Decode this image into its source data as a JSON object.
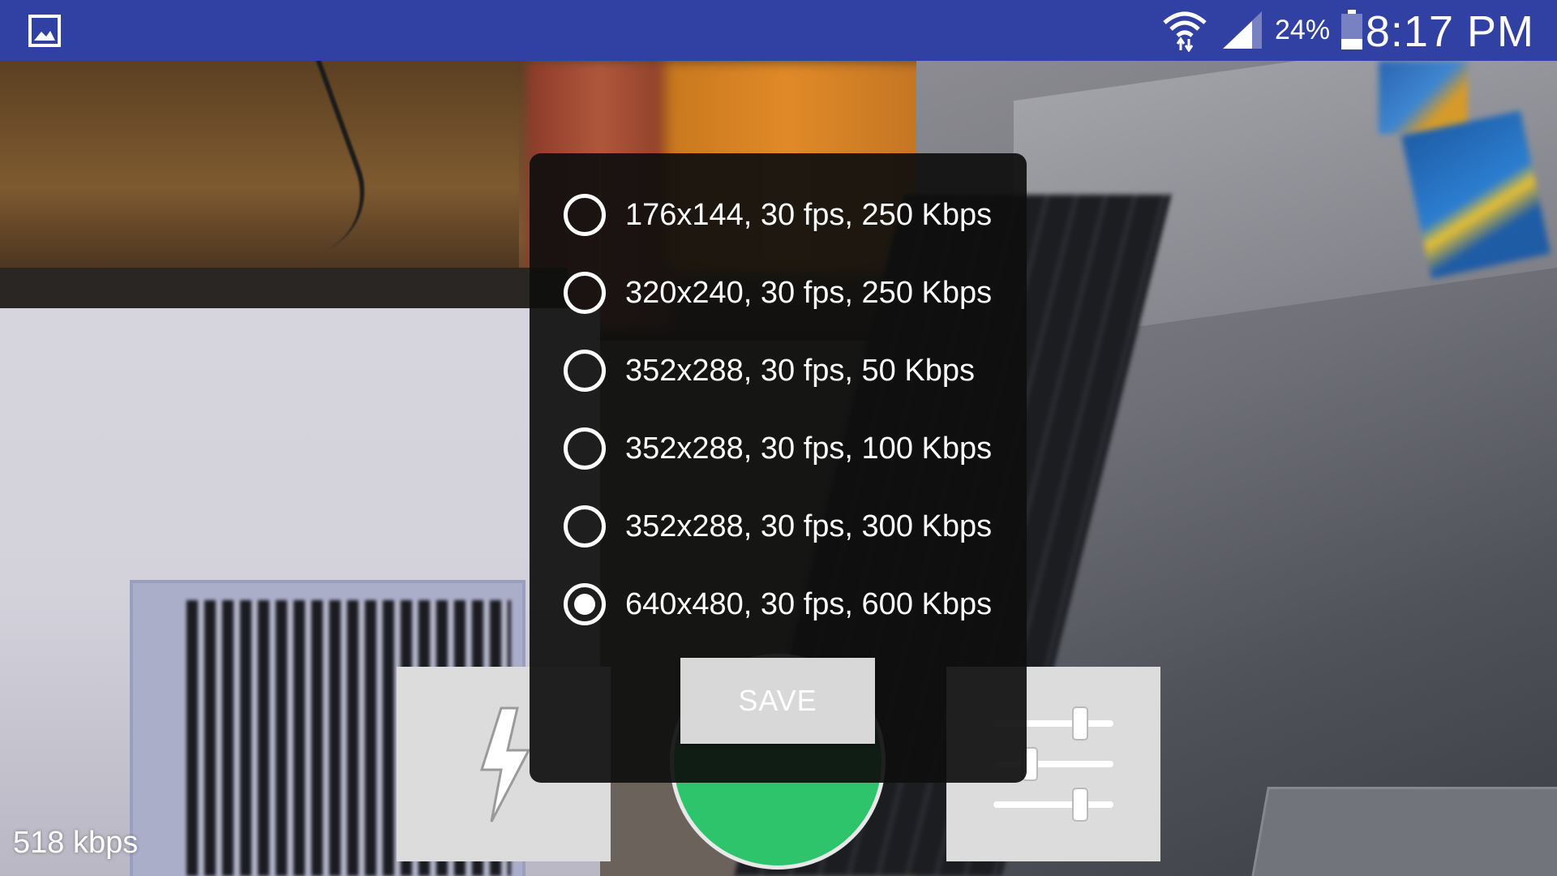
{
  "status_bar": {
    "battery_percent": "24%",
    "time": "8:17 PM",
    "icons": [
      "gallery-icon",
      "wifi-icon",
      "signal-icon",
      "battery-icon"
    ]
  },
  "dialog": {
    "options": [
      {
        "label": "176x144, 30 fps, 250 Kbps",
        "selected": false
      },
      {
        "label": "320x240, 30 fps, 250 Kbps",
        "selected": false
      },
      {
        "label": "352x288, 30 fps, 50 Kbps",
        "selected": false
      },
      {
        "label": "352x288, 30 fps, 100 Kbps",
        "selected": false
      },
      {
        "label": "352x288, 30 fps, 300 Kbps",
        "selected": false
      },
      {
        "label": "640x480, 30 fps, 600 Kbps",
        "selected": true
      }
    ],
    "save_label": "SAVE"
  },
  "controls": {
    "flash_icon": "lightning-bolt-icon",
    "settings_icon": "sliders-icon",
    "record_color": "#2ec46c"
  },
  "bitrate": "518 kbps",
  "colors": {
    "status_bar": "#3040a3",
    "dialog_bg": "#0e0e0e",
    "tile_bg": "#dcdcdc"
  }
}
